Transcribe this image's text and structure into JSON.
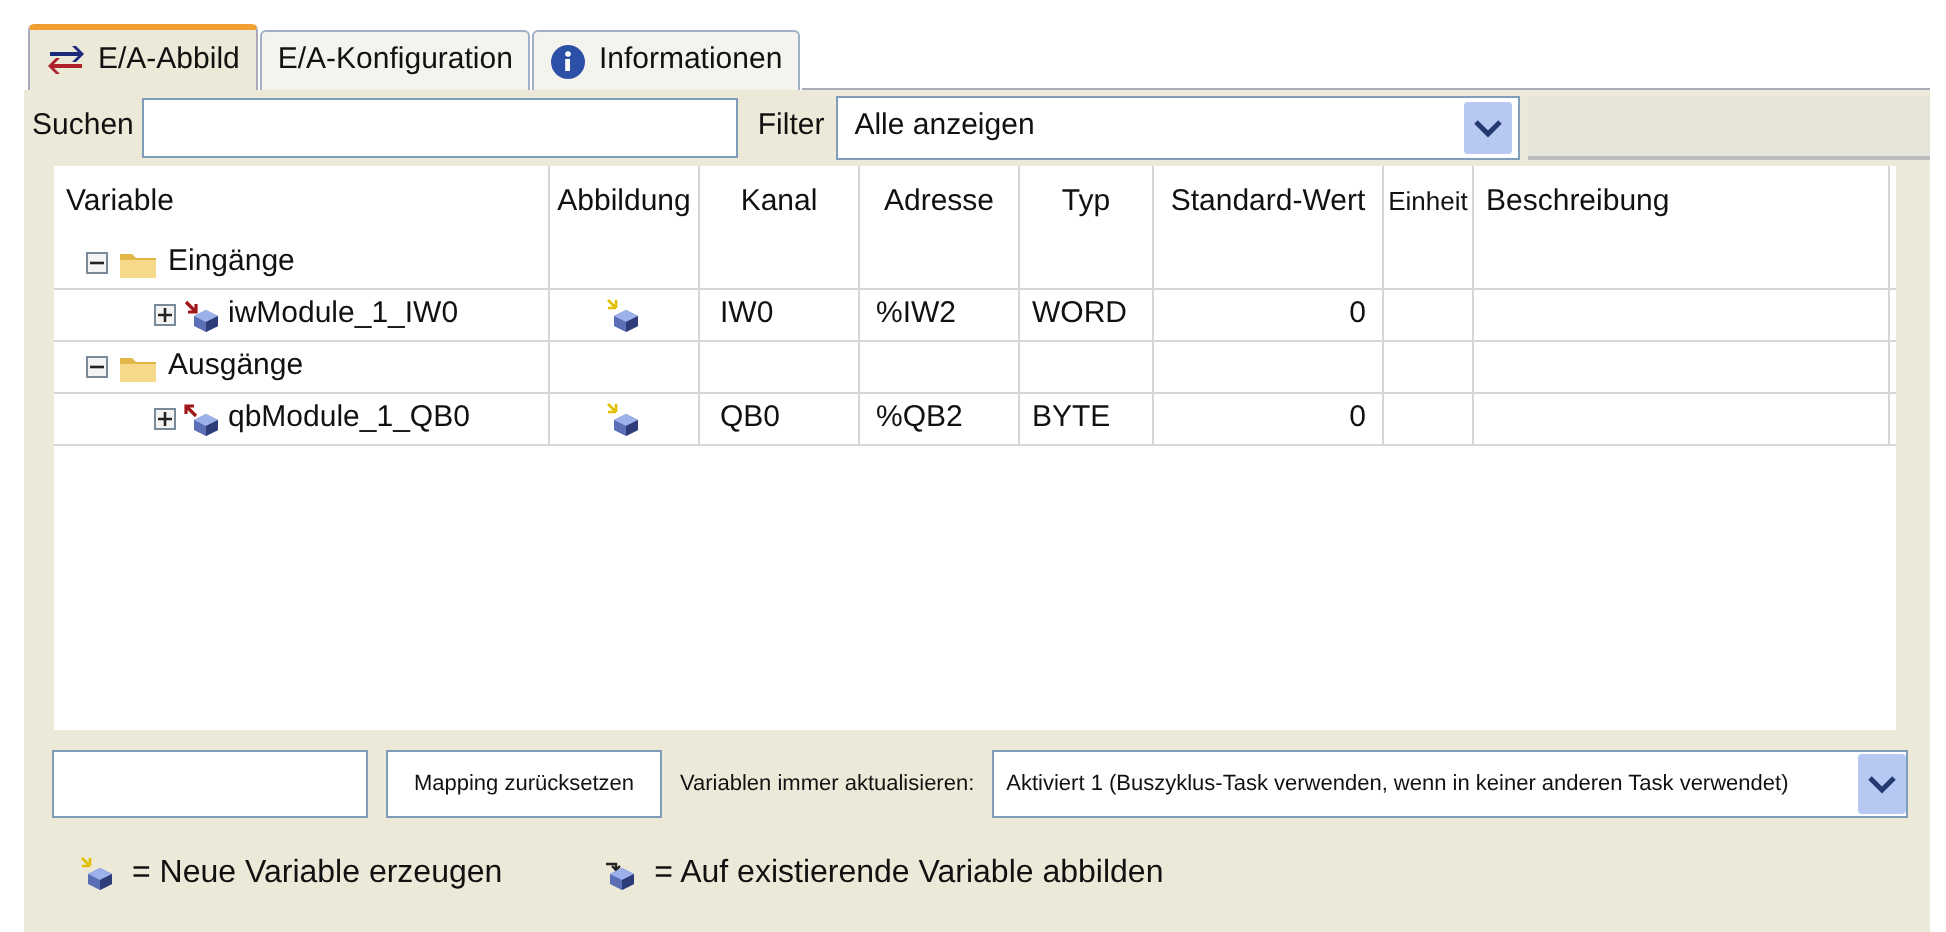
{
  "tabs": [
    {
      "label": "E/A-Abbild",
      "selected": true,
      "kind": "mapping"
    },
    {
      "label": "E/A-Konfiguration",
      "selected": false
    },
    {
      "label": "Informationen",
      "selected": false,
      "kind": "info"
    }
  ],
  "search": {
    "label": "Suchen"
  },
  "filter": {
    "label": "Filter",
    "value": "Alle anzeigen"
  },
  "table": {
    "columns": [
      "Variable",
      "Abbildung",
      "Kanal",
      "Adresse",
      "Typ",
      "Standard-Wert",
      "Einheit",
      "Beschreibung"
    ],
    "groups": [
      {
        "name": "Eingänge",
        "expanded": true,
        "children": [
          {
            "name": "iwModule_1_IW0",
            "kind": "input",
            "expanded": false,
            "channel": "IW0",
            "address": "%IW2",
            "type": "WORD",
            "default": "0"
          }
        ]
      },
      {
        "name": "Ausgänge",
        "expanded": true,
        "children": [
          {
            "name": "qbModule_1_QB0",
            "kind": "output",
            "expanded": false,
            "channel": "QB0",
            "address": "%QB2",
            "type": "BYTE",
            "default": "0"
          }
        ]
      }
    ]
  },
  "reset_button": "Mapping zurücksetzen",
  "update": {
    "label": "Variablen immer aktualisieren:",
    "value": "Aktiviert 1 (Buszyklus-Task verwenden, wenn in keiner anderen Task verwendet)"
  },
  "legend": [
    {
      "kind": "new",
      "text": "= Neue Variable erzeugen"
    },
    {
      "kind": "existing",
      "text": "= Auf existierende Variable abbilden"
    }
  ]
}
